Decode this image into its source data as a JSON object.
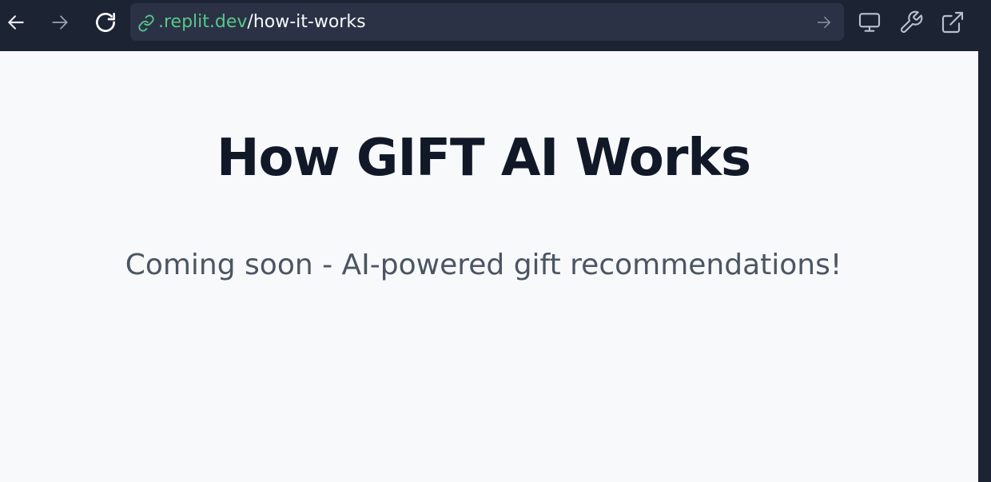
{
  "browser": {
    "back_icon": "arrow-left-icon",
    "forward_icon": "arrow-right-icon",
    "reload_icon": "reload-icon",
    "url": {
      "domain": ".replit.dev",
      "path": "/how-it-works"
    },
    "right_icons": [
      "desktop-icon",
      "wrench-icon",
      "external-link-icon"
    ]
  },
  "page": {
    "title": "How GIFT AI Works",
    "subtitle": "Coming soon - AI-powered gift recommendations!"
  },
  "colors": {
    "toolbar_bg": "#1c2333",
    "urlbar_bg": "#2b3245",
    "domain_green": "#58c78a",
    "page_bg": "#f8f9fb",
    "title": "#111827",
    "subtitle": "#4b5563"
  }
}
